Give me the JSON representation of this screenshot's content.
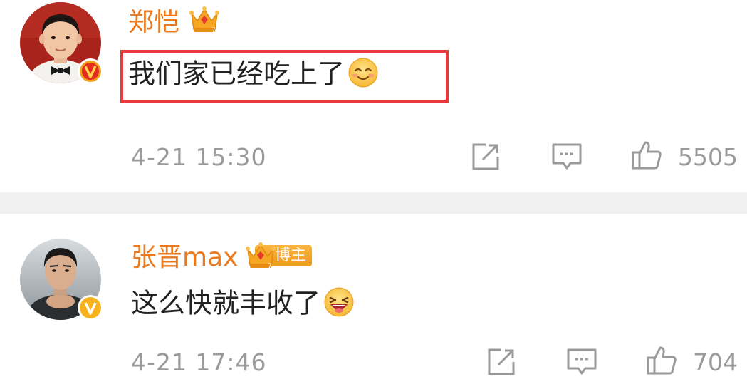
{
  "comments": [
    {
      "username": "郑恺",
      "text": "我们家已经吃上了",
      "time": "4-21 15:30",
      "likes": "5505",
      "highlighted": true
    },
    {
      "username": "张晋max",
      "tag": "博主",
      "text": "这么快就丰收了",
      "time": "4-21 17:46",
      "likes": "704",
      "highlighted": false
    }
  ],
  "colors": {
    "username": "#eb7a1e",
    "highlight_border": "#e8393f",
    "meta_gray": "#9a9a9a",
    "divider": "#f1f1f1"
  },
  "icons": {
    "avatar_badge_1": "red-verified-v-icon",
    "avatar_badge_2": "yellow-verified-v-icon",
    "member_badge": "crown-icon",
    "emoji_1": "smile-emoji-icon",
    "emoji_2": "laugh-emoji-icon",
    "share": "share-icon",
    "reply": "comment-icon",
    "like": "thumbs-up-icon"
  }
}
